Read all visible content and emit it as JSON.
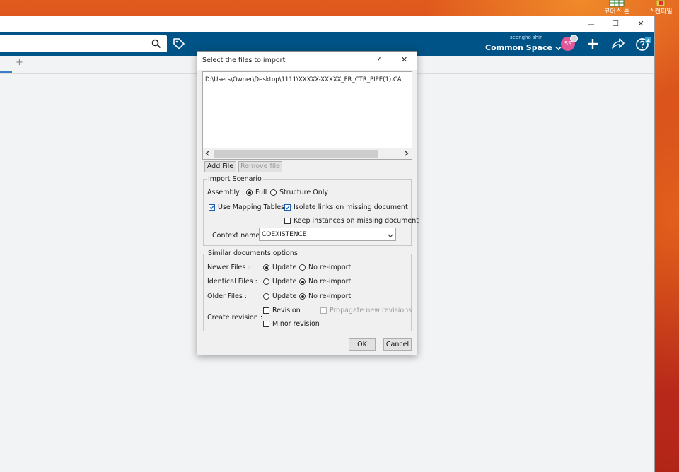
{
  "desktop": {
    "icons": [
      {
        "label": "코어스 톤",
        "icon": "spreadsheet-icon"
      },
      {
        "label": "스캔파일",
        "icon": "folder-icon"
      }
    ]
  },
  "window": {
    "minimize_glyph": "—",
    "maximize_glyph": "☐",
    "close_glyph": "✕"
  },
  "topbar": {
    "user_name": "seongho shin",
    "space_label": "Common Space",
    "avatar_initials": "SS",
    "colors": {
      "bar": "#005386",
      "avatar": "#e0589a"
    }
  },
  "tabs": {
    "add_glyph": "+"
  },
  "dialog": {
    "title": "Select the files to import",
    "help_glyph": "?",
    "close_glyph": "✕",
    "file_path": "D:\\Users\\Owner\\Desktop\\1111\\XXXXX-XXXXX_FR_CTR_PIPE(1).CA",
    "add_file_label": "Add File",
    "remove_file_label": "Remove file",
    "import_scenario": {
      "title": "Import Scenario",
      "assembly_label": "Assembly :",
      "full_label": "Full",
      "structure_only_label": "Structure Only",
      "use_mapping_tables_label": "Use Mapping Tables",
      "isolate_links_label": "Isolate links on missing document",
      "keep_instances_label": "Keep instances on missing document",
      "context_name_label": "Context name",
      "context_name_value": "COEXISTENCE",
      "full_selected": true,
      "use_mapping_tables_checked": true,
      "isolate_links_checked": true,
      "keep_instances_checked": false
    },
    "similar": {
      "title": "Similar documents options",
      "newer_label": "Newer Files :",
      "identical_label": "Identical Files :",
      "older_label": "Older Files :",
      "update_label": "Update",
      "no_reimport_label": "No re-import",
      "newer_choice": "update",
      "identical_choice": "no-reimport",
      "older_choice": "no-reimport",
      "create_revision_label": "Create revision :",
      "revision_label": "Revision",
      "propagate_label": "Propagate new revisions",
      "minor_revision_label": "Minor revision"
    },
    "ok_label": "OK",
    "cancel_label": "Cancel"
  }
}
